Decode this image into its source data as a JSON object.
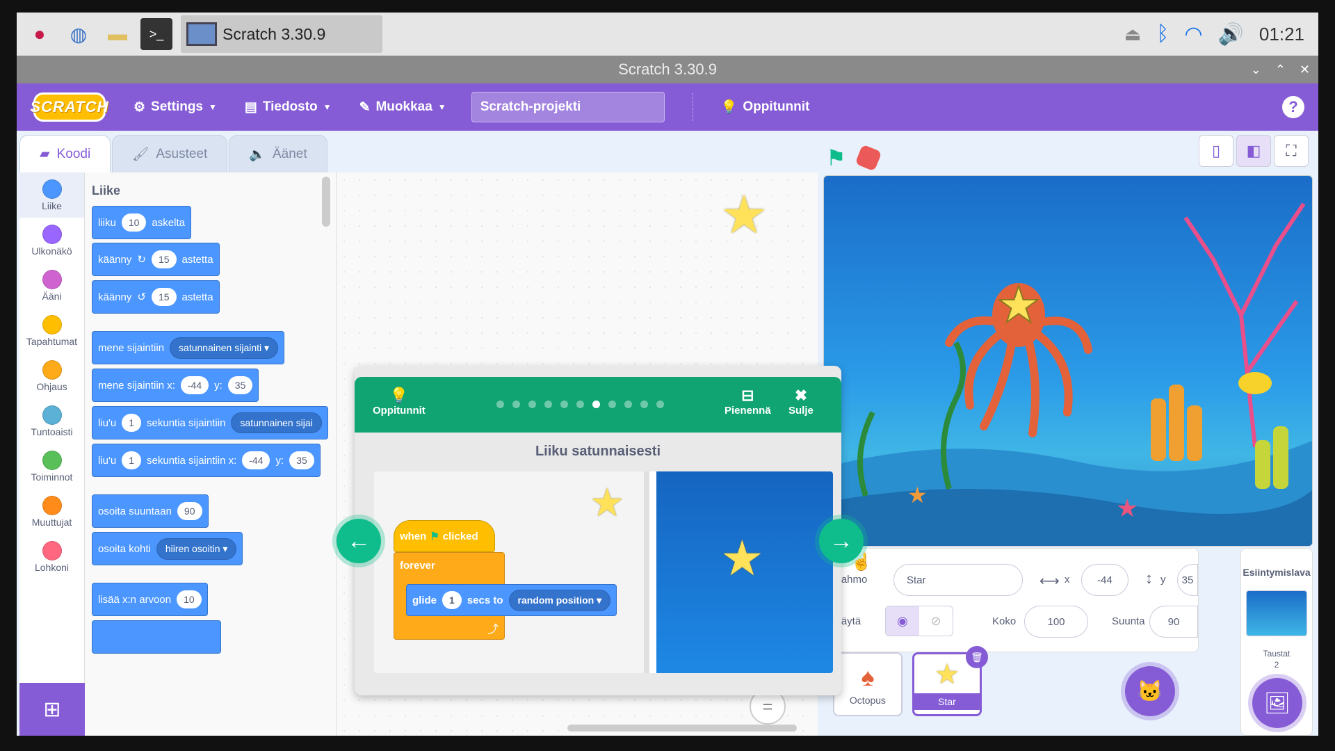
{
  "taskbar": {
    "task_label": "Scratch 3.30.9",
    "clock": "01:21",
    "icons": [
      "raspberry-icon",
      "browser-icon",
      "folder-icon",
      "terminal-icon",
      "eject-icon",
      "bluetooth-icon",
      "wifi-icon",
      "volume-icon"
    ]
  },
  "window": {
    "title": "Scratch 3.30.9"
  },
  "menubar": {
    "logo": "SCRATCH",
    "settings": "Settings",
    "file": "Tiedosto",
    "edit": "Muokkaa",
    "project_title": "Scratch-projekti",
    "tutorials": "Oppitunnit",
    "help": "?"
  },
  "tabs": {
    "code": "Koodi",
    "costumes": "Asusteet",
    "sounds": "Äänet"
  },
  "categories": [
    {
      "label": "Liike",
      "color": "#4c97ff"
    },
    {
      "label": "Ulkonäkö",
      "color": "#9966ff"
    },
    {
      "label": "Ääni",
      "color": "#cf63cf"
    },
    {
      "label": "Tapahtumat",
      "color": "#ffbf00"
    },
    {
      "label": "Ohjaus",
      "color": "#ffab19"
    },
    {
      "label": "Tuntoaisti",
      "color": "#5cb1d6"
    },
    {
      "label": "Toiminnot",
      "color": "#59c059"
    },
    {
      "label": "Muuttujat",
      "color": "#ff8c1a"
    },
    {
      "label": "Lohkoni",
      "color": "#ff6680"
    }
  ],
  "flyout": {
    "heading": "Liike",
    "b1": {
      "pre": "liiku",
      "v": "10",
      "post": "askelta"
    },
    "b2": {
      "pre": "käänny",
      "v": "15",
      "post": "astetta"
    },
    "b3": {
      "pre": "käänny",
      "v": "15",
      "post": "astetta"
    },
    "b4": {
      "pre": "mene sijaintiin",
      "dd": "satunnainen sijainti"
    },
    "b5": {
      "pre": "mene sijaintiin x:",
      "x": "-44",
      "ylbl": "y:",
      "y": "35"
    },
    "b6": {
      "pre": "liu'u",
      "v": "1",
      "mid": "sekuntia sijaintiin",
      "dd": "satunnainen sijai"
    },
    "b7": {
      "pre": "liu'u",
      "v": "1",
      "mid": "sekuntia sijaintiin x:",
      "x": "-44",
      "ylbl": "y:",
      "y": "35"
    },
    "b8": {
      "pre": "osoita suuntaan",
      "v": "90"
    },
    "b9": {
      "pre": "osoita kohti",
      "dd": "hiiren osoitin"
    },
    "b10": {
      "pre": "lisää x:n arvoon",
      "v": "10"
    }
  },
  "tutorial": {
    "header_label": "Oppitunnit",
    "total_steps": 11,
    "current_step": 7,
    "shrink": "Pienennä",
    "close": "Sulje",
    "title": "Liiku satunnaisesti",
    "hat": {
      "pre": "when",
      "post": "clicked"
    },
    "forever": "forever",
    "glide": {
      "pre": "glide",
      "v": "1",
      "mid": "secs to",
      "dd": "random position"
    }
  },
  "sprite_info": {
    "sprite_label": "Hahmo",
    "sprite_name": "Star",
    "x_label": "x",
    "x": "-44",
    "y_label": "y",
    "y": "35",
    "show_label": "Näytä",
    "size_label": "Koko",
    "size": "100",
    "direction_label": "Suunta",
    "direction": "90"
  },
  "sprites": [
    {
      "name": "Octopus",
      "selected": false
    },
    {
      "name": "Star",
      "selected": true
    }
  ],
  "stage_pane": {
    "title": "Esiintymislava",
    "backdrops_label": "Taustat",
    "backdrops_count": "2"
  }
}
